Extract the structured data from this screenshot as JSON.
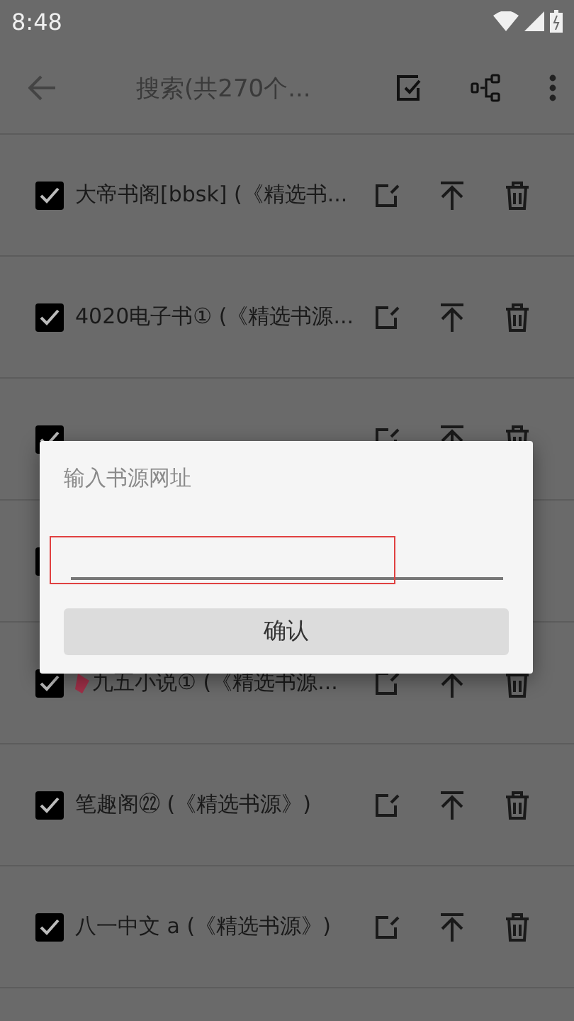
{
  "status_bar": {
    "time": "8:48"
  },
  "toolbar": {
    "title": "搜索(共270个..."
  },
  "rows": [
    {
      "name": "大帝书阁[bbsk] (《精选书...",
      "checked": true,
      "tagged": false
    },
    {
      "name": "4020电子书① (《精选书源...",
      "checked": true,
      "tagged": false
    },
    {
      "checked": true
    },
    {
      "checked": true
    },
    {
      "name": "九五小说① (《精选书源...",
      "checked": true,
      "tagged": true
    },
    {
      "name": "笔趣阁㉒ (《精选书源》)",
      "checked": true,
      "tagged": false
    },
    {
      "name": "八一中文 a (《精选书源》)",
      "checked": true,
      "tagged": false
    }
  ],
  "dialog": {
    "title": "输入书源网址",
    "input": {
      "highlighted": true
    },
    "button": "确认"
  }
}
